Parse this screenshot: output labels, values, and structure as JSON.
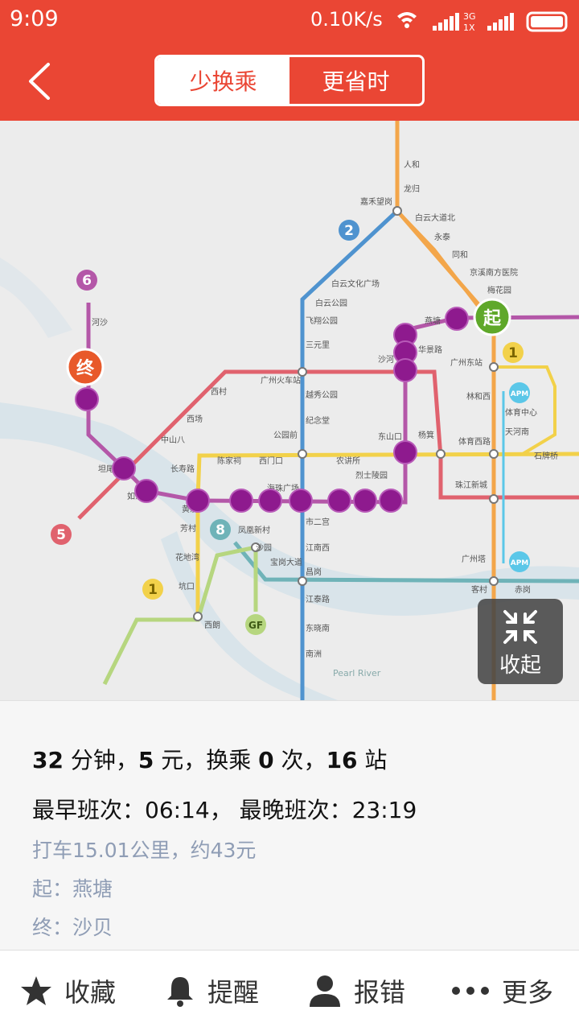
{
  "status": {
    "time": "9:09",
    "speed": "0.10K/s",
    "network": "3G",
    "sim": "1X"
  },
  "header": {
    "tabs": [
      {
        "label": "少换乘",
        "active": true
      },
      {
        "label": "更省时",
        "active": false
      }
    ]
  },
  "map": {
    "start_marker": "起",
    "end_marker": "终",
    "collapse_label": "收起",
    "line_numbers": [
      "6",
      "2",
      "1",
      "5",
      "8",
      "1",
      "GF"
    ],
    "apm_label": "APM",
    "stations": {
      "jiahe": "嘉禾望岗",
      "baiyun_culture": "白云文化广场",
      "baiyun_park": "白云公园",
      "feixiang": "飞翔公园",
      "sanyuanli": "三元里",
      "guangzhou_station": "广州火车站",
      "yuexiu_park": "越秀公园",
      "jinian": "纪念堂",
      "gongyuanqian": "公园前",
      "haizhu": "海珠广场",
      "shierqiao": "市二宫",
      "jiangnanxi": "江南西",
      "changgang": "昌岗",
      "jiangtai": "江泰路",
      "dongxiaonan": "东晓南",
      "nanzhou": "南洲",
      "xilang": "西朗",
      "huangsha": "黄沙",
      "changshou": "长寿路",
      "chenjiaci": "陈家祠",
      "ximenkou": "西门口",
      "nongjiang": "农讲所",
      "liezhu": "烈士陵园",
      "dongshankou": "东山口",
      "yangji": "杨箕",
      "tiyu_west": "体育西路",
      "zhujiang": "珠江新城",
      "linhexi": "林和西",
      "guangzhou_east": "广州东站",
      "tianhe_sports": "体育中心",
      "tianhenan": "天河南",
      "shipaiqiao": "石牌桥",
      "guangzhou_tower": "广州塔",
      "kecun": "客村",
      "chigang": "赤岗",
      "zhongshanba": "中山八",
      "xicun": "西村",
      "ximen": "西场",
      "tanwei": "坦尾",
      "rudikou": "如意坊",
      "hedong": "河沙",
      "fangcun": "芳村",
      "huadiwan": "花地湾",
      "kengkou": "坑口",
      "shayuan": "沙园",
      "baogang": "宝岗大道",
      "fenghuang": "凤凰新村",
      "renhe": "人和",
      "longgui": "龙归",
      "baiyun_avenue": "白云大道北",
      "yongtai": "永泰",
      "tonghe": "同和",
      "jingxi": "京溪南方医院",
      "meihua": "梅花园",
      "yantang": "燕塘",
      "huajing": "华景路",
      "sha_he": "沙河"
    },
    "river_label": "Pearl River"
  },
  "info": {
    "summary": {
      "minutes": "32",
      "minutes_unit": " 分钟，",
      "fare": "5",
      "fare_unit": " 元，换乘 ",
      "transfers": "0",
      "transfers_unit": " 次，",
      "stations": "16",
      "stations_unit": " 站"
    },
    "times": "最早班次：06:14， 最晚班次：23:19",
    "taxi": "打车15.01公里，约43元",
    "start": "起：燕塘",
    "end": "终：沙贝"
  },
  "actions": [
    {
      "label": "收藏",
      "icon": "star-icon"
    },
    {
      "label": "提醒",
      "icon": "bell-icon"
    },
    {
      "label": "报错",
      "icon": "person-icon"
    },
    {
      "label": "更多",
      "icon": "more-icon"
    }
  ],
  "colors": {
    "brand": "#ea4634",
    "route_marker": "#8e1a8e",
    "start_marker": "#5fa82a",
    "end_marker": "#e8592a",
    "line1": "#f2d14a",
    "line2": "#4f93cf",
    "line3": "#f3a64a",
    "line5": "#e0626e",
    "line6": "#b457a8",
    "line8": "#6fb3b8",
    "line_gf": "#b6d67f",
    "apm": "#5bc7e8"
  }
}
